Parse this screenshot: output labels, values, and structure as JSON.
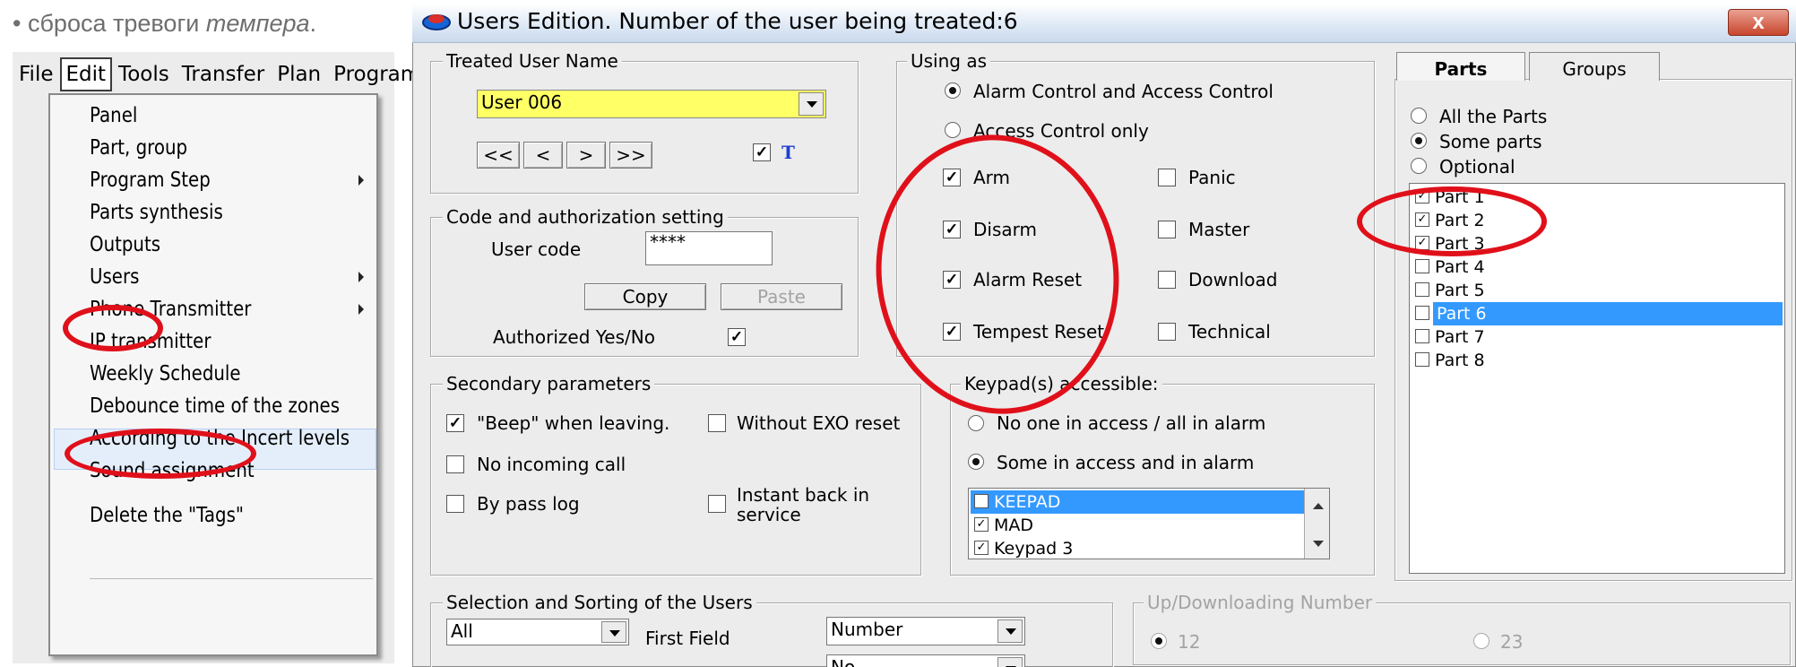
{
  "caption": {
    "bullet": "•",
    "prefix": "сброса тревоги ",
    "italic": "темпера",
    "suffix": "."
  },
  "menubar": [
    "File",
    "Edit",
    "Tools",
    "Transfer",
    "Plan",
    "Programmabl"
  ],
  "edit_menu": {
    "items": [
      {
        "label": "Panel",
        "submenu": false
      },
      {
        "label": "Part, group",
        "submenu": false
      },
      {
        "label": "Program Step",
        "submenu": true
      },
      {
        "label": "Parts synthesis",
        "submenu": false
      },
      {
        "label": "Outputs",
        "submenu": false
      },
      {
        "label": "Users",
        "submenu": true
      },
      {
        "label": "Phone Transmitter",
        "submenu": true
      },
      {
        "label": "IP transmitter",
        "submenu": false
      },
      {
        "label": "Weekly Schedule",
        "submenu": false
      },
      {
        "label": "Debounce time of the zones",
        "submenu": false
      },
      {
        "label": "According to the Incert levels",
        "submenu": false
      },
      {
        "label": "Sound assignment",
        "submenu": false
      },
      {
        "label": "Delete the \"Tags\"",
        "submenu": false
      }
    ],
    "highlighted": "Weekly Schedule"
  },
  "dialog": {
    "title": "Users Edition.  Number of the user being treated:6",
    "close": "x",
    "treated_user": {
      "legend": "Treated User Name",
      "value": "User 006",
      "nav": [
        "<<",
        "<",
        ">",
        ">>"
      ],
      "t_checked": true,
      "t_label": "T"
    },
    "code": {
      "legend": "Code and authorization setting",
      "user_code_label": "User code",
      "user_code_value": "****",
      "copy": "Copy",
      "paste": "Paste",
      "authorized_label": "Authorized Yes/No",
      "authorized": true
    },
    "using_as": {
      "legend": "Using as",
      "radios": [
        {
          "label": "Alarm Control and Access Control",
          "selected": true
        },
        {
          "label": "Access Control only",
          "selected": false
        }
      ],
      "checks_left": [
        {
          "label": "Arm",
          "checked": true
        },
        {
          "label": "Disarm",
          "checked": true
        },
        {
          "label": "Alarm Reset",
          "checked": true
        },
        {
          "label": "Tempest Reset",
          "checked": true
        }
      ],
      "checks_right": [
        {
          "label": "Panic",
          "checked": false
        },
        {
          "label": "Master",
          "checked": false
        },
        {
          "label": "Download",
          "checked": false
        },
        {
          "label": "Technical",
          "checked": false
        }
      ]
    },
    "secondary": {
      "legend": "Secondary parameters",
      "beep": {
        "label": "\"Beep\" when leaving.",
        "checked": true
      },
      "no_incoming": {
        "label": "No incoming call",
        "checked": false
      },
      "bypass_log": {
        "label": "By pass log",
        "checked": false
      },
      "without_exo": {
        "label": "Without EXO reset",
        "checked": false
      },
      "instant_back_1": "Instant back in",
      "instant_back_2": "service",
      "instant_back_checked": false
    },
    "keypads": {
      "legend": "Keypad(s) accessible:",
      "radios": [
        {
          "label": "No one in access / all in alarm",
          "selected": false
        },
        {
          "label": "Some in access and in alarm",
          "selected": true
        }
      ],
      "list": [
        {
          "label": "KEEPAD",
          "checked": true,
          "selected": true
        },
        {
          "label": "MAD",
          "checked": true,
          "selected": false
        },
        {
          "label": "Keypad 3",
          "checked": true,
          "selected": false
        }
      ]
    },
    "parts": {
      "tabs": [
        "Parts",
        "Groups"
      ],
      "active_tab": "Parts",
      "radios": [
        {
          "label": "All the Parts",
          "selected": false
        },
        {
          "label": "Some parts",
          "selected": true
        },
        {
          "label": "Optional",
          "selected": false
        }
      ],
      "list": [
        {
          "label": "Part 1",
          "checked": true,
          "selected": false
        },
        {
          "label": "Part 2",
          "checked": true,
          "selected": false
        },
        {
          "label": "Part 3",
          "checked": true,
          "selected": false
        },
        {
          "label": "Part 4",
          "checked": false,
          "selected": false
        },
        {
          "label": "Part 5",
          "checked": false,
          "selected": false
        },
        {
          "label": "Part 6",
          "checked": false,
          "selected": true
        },
        {
          "label": "Part 7",
          "checked": false,
          "selected": false
        },
        {
          "label": "Part 8",
          "checked": false,
          "selected": false
        }
      ]
    },
    "selection": {
      "legend": "Selection and Sorting of the Users",
      "filter_value": "All",
      "first_field_label": "First Field",
      "first_field_value": "Number",
      "second_field_value": "No"
    },
    "updown": {
      "legend": "Up/Downloading Number",
      "opt1": "12",
      "opt1_selected": true,
      "opt2": "23",
      "opt2_selected": false
    }
  },
  "colors": {
    "highlight_yellow": "#ffff66",
    "selection_blue": "#3399ff",
    "annotation_red": "#e0101a",
    "title_blue": "#1f3fd0"
  }
}
